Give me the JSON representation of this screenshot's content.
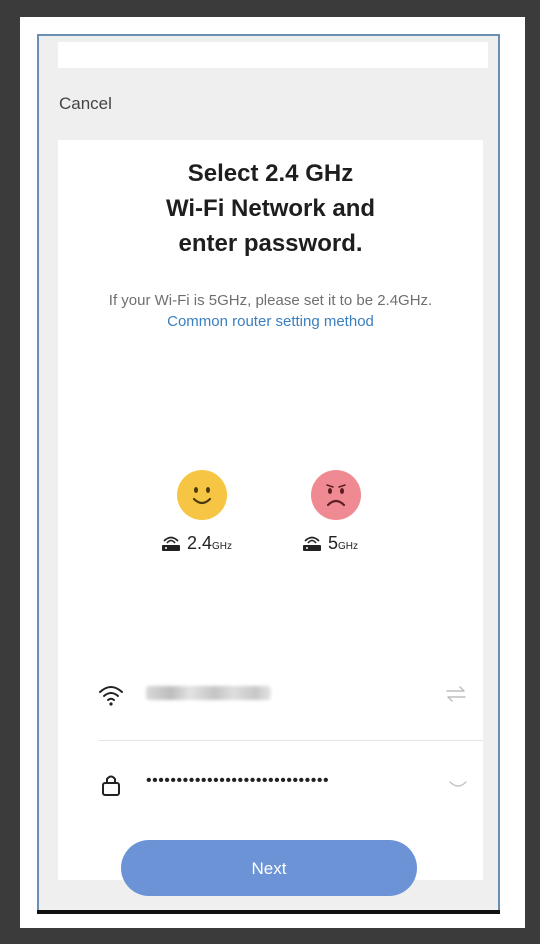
{
  "header": {
    "cancel_label": "Cancel"
  },
  "main": {
    "title_lines": [
      "Select 2.4 GHz",
      "Wi-Fi Network and",
      "enter password."
    ],
    "description": "If your Wi-Fi is 5GHz, please set it to be 2.4GHz.",
    "link_text": "Common router setting method",
    "bands": [
      {
        "value": "2.4",
        "unit": "GHz",
        "face": "happy"
      },
      {
        "value": "5",
        "unit": "GHz",
        "face": "sad"
      }
    ]
  },
  "form": {
    "wifi_icon": "wifi-icon",
    "password_value": "••••••••••••••••••••••••••••••",
    "next_label": "Next"
  },
  "colors": {
    "accent": "#6b93d6",
    "link": "#3a7fbf",
    "happy_face": "#f6c544",
    "sad_face": "#f08a92"
  }
}
